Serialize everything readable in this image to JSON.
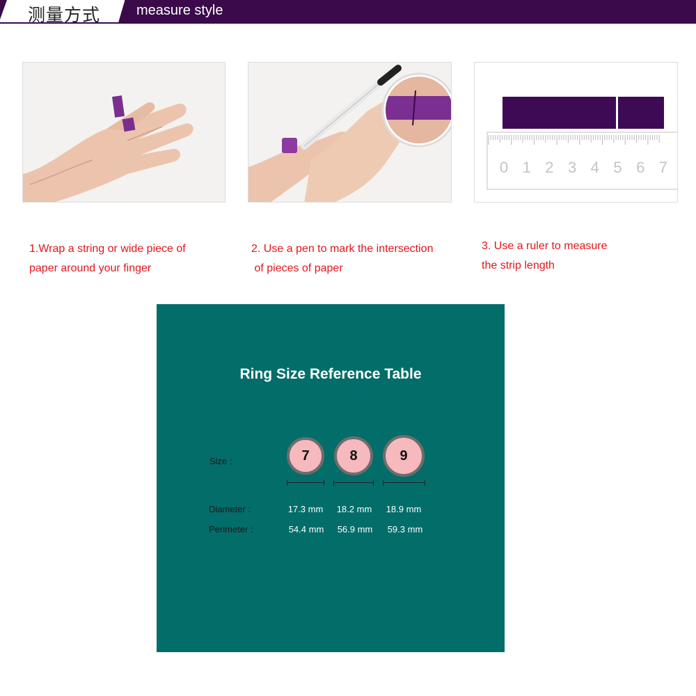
{
  "header": {
    "title_cn": "测量方式",
    "title_en": "measure style",
    "color": "#3a0a4a"
  },
  "steps": [
    {
      "line1": "1.Wrap a string or wide piece of",
      "line2": "paper around your finger"
    },
    {
      "line1": "2. Use a pen to mark the intersection",
      "line2": " of pieces of paper"
    },
    {
      "line1": "3. Use a ruler to measure",
      "line2": "the strip length"
    }
  ],
  "ruler": {
    "digits": [
      "0",
      "1",
      "2",
      "3",
      "4",
      "5",
      "6",
      "7"
    ]
  },
  "reference": {
    "title": "Ring Size Reference Table",
    "size_label": "Size :",
    "diameter_label": "Diameter :",
    "perimeter_label": "Perimeter :",
    "sizes": [
      "7",
      "8",
      "9"
    ],
    "diameters": [
      "17.3 mm",
      "18.2 mm",
      "18.9 mm"
    ],
    "perimeters": [
      "54.4 mm",
      "56.9 mm",
      "59.3 mm"
    ],
    "background_color": "#036d69",
    "ring_color": "#f6b9bd"
  }
}
